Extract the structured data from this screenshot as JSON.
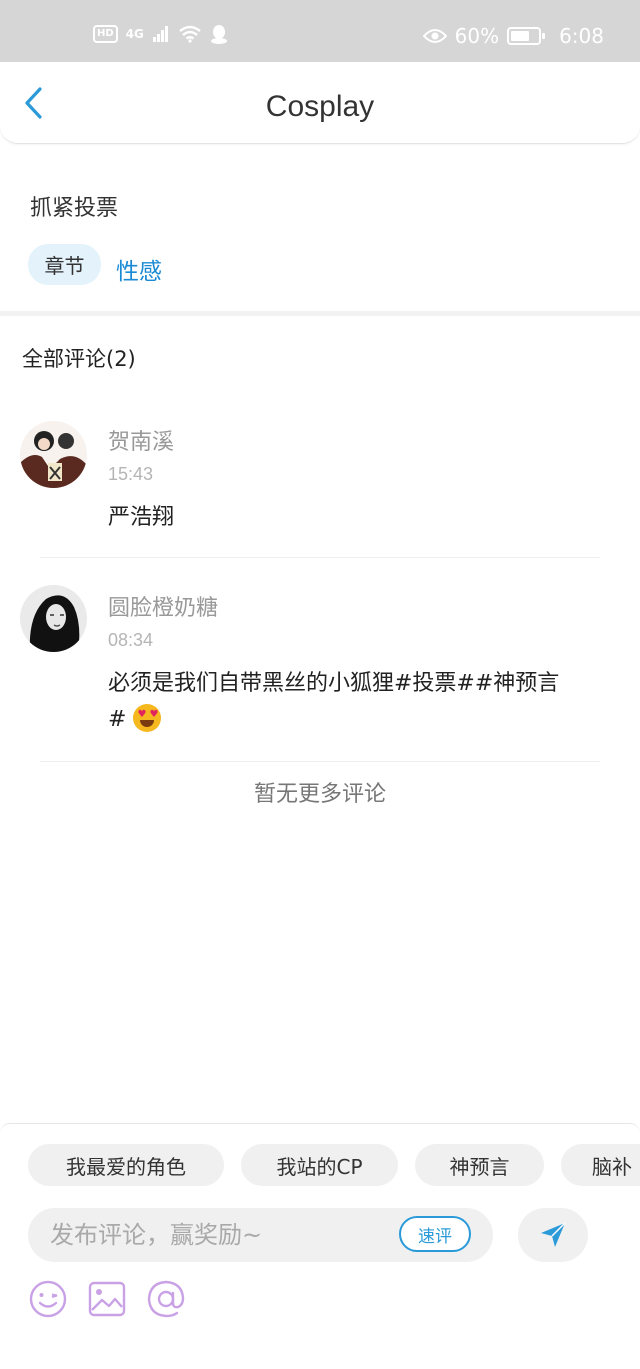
{
  "status_bar": {
    "hd": "HD",
    "signal": "4G",
    "battery": "60%",
    "time": "6:08",
    "icons": [
      "hd-icon",
      "signal-icon",
      "wifi-icon",
      "qq-icon",
      "eye-icon",
      "battery-icon"
    ]
  },
  "header": {
    "title": "Cosplay",
    "back_icon": "chevron-left-icon"
  },
  "topic": {
    "title": "抓紧投票",
    "tag_label": "章节",
    "tag_value": "性感"
  },
  "comments": {
    "header": "全部评论(2)",
    "items": [
      {
        "name": "贺南溪",
        "time": "15:43",
        "text": "严浩翔"
      },
      {
        "name": "圆脸橙奶糖",
        "time": "08:34",
        "text_line1": "必须是我们自带黑丝的小狐狸#投票##神预言",
        "text_line2": "#"
      }
    ],
    "no_more": "暂无更多评论"
  },
  "composer": {
    "quick_chips": [
      "我最爱的角色",
      "我站的CP",
      "神预言",
      "脑补"
    ],
    "placeholder": "发布评论，赢奖励~",
    "quick_review": "速评",
    "send_icon": "send-icon",
    "tools": [
      "emoji-icon",
      "image-icon",
      "mention-icon"
    ]
  },
  "colors": {
    "accent": "#1a8ad4",
    "tool_purple": "#c9a2e6",
    "tag_bg": "#e3f2fb"
  }
}
